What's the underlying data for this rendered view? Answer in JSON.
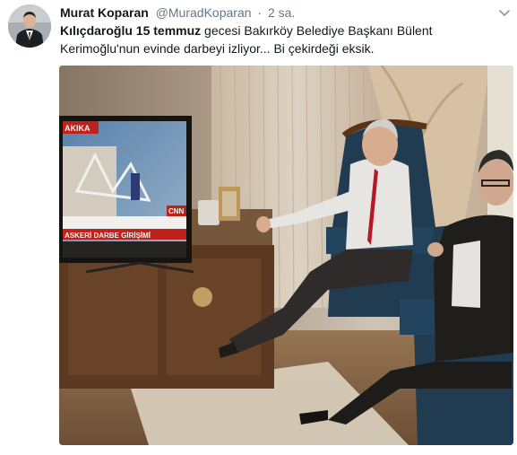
{
  "tweet": {
    "author_name": "Murat Koparan",
    "author_handle": "@MuradKoparan",
    "separator": "·",
    "time": "2 sa.",
    "text_bold_1": "Kılıçdaroğlu 15 temmuz",
    "text_rest_1": " gecesi Bakırköy Belediye Başkanı Bülent Kerimoğlu'nun evinde darbeyi izliyor... Bi çekirdeği eksik.",
    "avatar_icon": "person-in-suit-avatar",
    "menu_icon": "chevron-down-icon"
  },
  "photo": {
    "tv_brand_text": "CNN",
    "tv_bar_text": "ASKERİ DARBE GİRİŞİMİ",
    "tv_corner_text": "AKIKA"
  },
  "colors": {
    "text": "#14171a",
    "secondary": "#657786",
    "tv_red": "#c8201e"
  }
}
